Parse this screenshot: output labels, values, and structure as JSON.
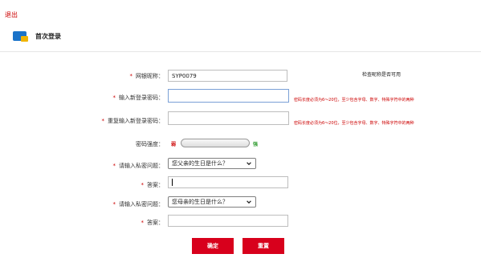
{
  "header": {
    "logout": "退出",
    "title": "首次登录"
  },
  "form": {
    "nickname": {
      "label": "网银昵称：",
      "value": "SYP0079",
      "hint": "检查昵称是否可用"
    },
    "new_password": {
      "label": "输入新登录密码：",
      "value": "",
      "error": "密码长度必须为6～20位，至少包含字母、数字、特殊字符中的两种"
    },
    "confirm_password": {
      "label": "重复输入新登录密码：",
      "value": "",
      "error": "密码长度必须为6～20位，至少包含字母、数字、特殊字符中的两种"
    },
    "strength": {
      "label": "密码强度：",
      "weak": "弱",
      "strong": "强",
      "level": 0
    },
    "question1": {
      "label": "请输入私密问题：",
      "selected": "您父亲的生日是什么？"
    },
    "answer1": {
      "label": "答案：",
      "value": ""
    },
    "question2": {
      "label": "请输入私密问题：",
      "selected": "您母亲的生日是什么？"
    },
    "answer2": {
      "label": "答案：",
      "value": ""
    }
  },
  "buttons": {
    "confirm": "确定",
    "reset": "重置"
  },
  "colors": {
    "accent": "#d8001c",
    "error": "#cc0000",
    "strong": "#2e9b2e"
  }
}
